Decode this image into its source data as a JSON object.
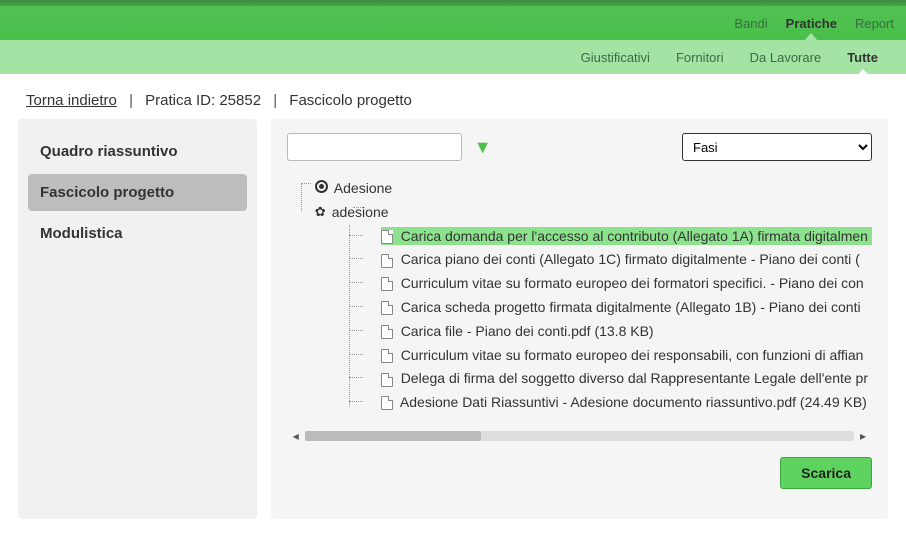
{
  "nav1": {
    "items": [
      {
        "label": "Bandi"
      },
      {
        "label": "Pratiche",
        "active": true
      },
      {
        "label": "Report"
      }
    ]
  },
  "nav2": {
    "items": [
      {
        "label": "Giustificativi"
      },
      {
        "label": "Fornitori"
      },
      {
        "label": "Da Lavorare"
      },
      {
        "label": "Tutte",
        "active": true
      }
    ]
  },
  "breadcrumb": {
    "back_label": "Torna indietro",
    "pratica_label": "Pratica ID: 25852",
    "section_label": "Fascicolo progetto"
  },
  "sidebar": {
    "items": [
      {
        "label": "Quadro riassuntivo"
      },
      {
        "label": "Fascicolo progetto",
        "active": true
      },
      {
        "label": "Modulistica"
      }
    ]
  },
  "filters": {
    "search_placeholder": "",
    "phase_selected": "Fasi"
  },
  "tree": {
    "root_label": "Adesione",
    "sub_label": "adesione",
    "docs": [
      {
        "label": "Carica domanda per l'accesso al contributo (Allegato 1A) firmata digitalmen",
        "selected": true
      },
      {
        "label": "Carica piano dei conti (Allegato 1C) firmato digitalmente - Piano dei conti ("
      },
      {
        "label": "Curriculum vitae su formato europeo dei formatori specifici. - Piano dei con"
      },
      {
        "label": "Carica scheda progetto firmata digitalmente (Allegato 1B) - Piano dei conti"
      },
      {
        "label": "Carica file - Piano dei conti.pdf (13.8 KB)"
      },
      {
        "label": "Curriculum vitae su formato europeo dei responsabili, con funzioni di affian"
      },
      {
        "label": "Delega di firma del soggetto diverso dal Rappresentante Legale dell'ente pr"
      },
      {
        "label": "Adesione Dati Riassuntivi - Adesione documento riassuntivo.pdf (24.49 KB)"
      }
    ]
  },
  "actions": {
    "download_label": "Scarica"
  }
}
